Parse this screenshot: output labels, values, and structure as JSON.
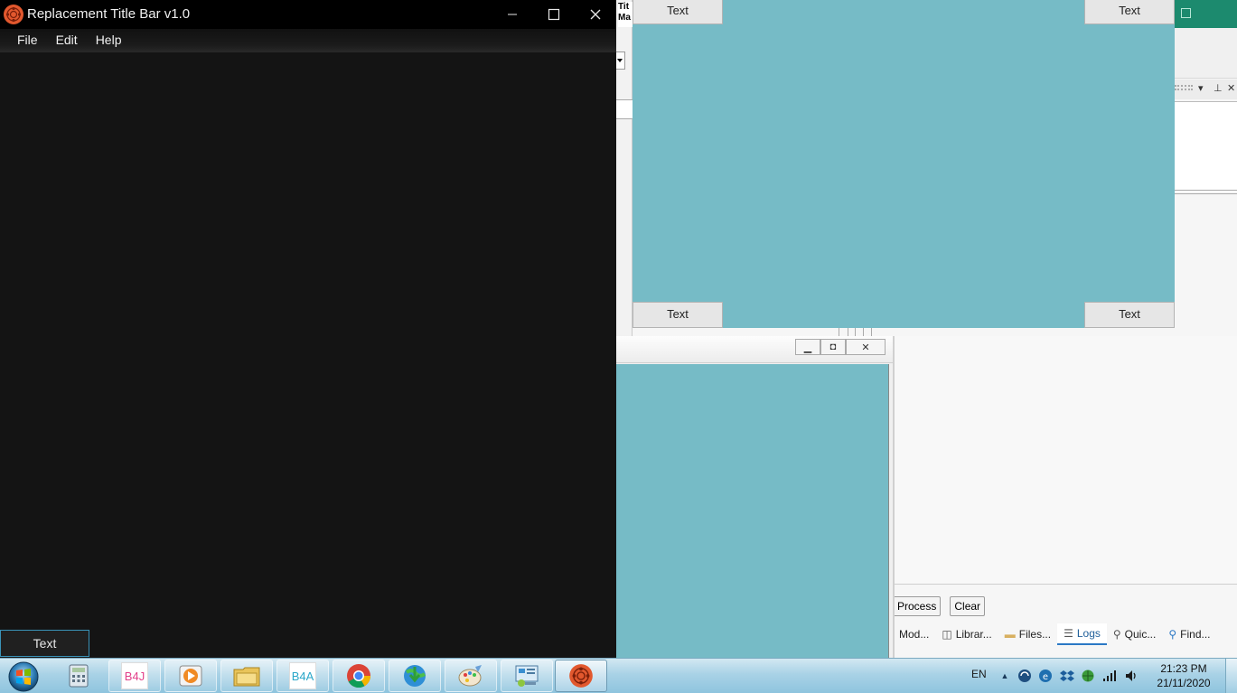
{
  "main_window": {
    "title": "Replacement Title Bar v1.0",
    "menu": [
      "File",
      "Edit",
      "Help"
    ],
    "bottom_button": "Text"
  },
  "designer_form": {
    "buttons": {
      "top_left": "Text",
      "top_right": "Text",
      "bottom_left": "Text",
      "bottom_right": "Text"
    }
  },
  "ide": {
    "title_fragment": "Tit Ma",
    "log_buttons": {
      "process": "Process",
      "clear": "Clear"
    },
    "panel_tabs": [
      {
        "label": "Mod...",
        "icon": ""
      },
      {
        "label": "Librar...",
        "icon": "📖"
      },
      {
        "label": "Files...",
        "icon": "📁"
      },
      {
        "label": "Logs",
        "icon": "☰"
      },
      {
        "label": "Quic...",
        "icon": "🔍"
      },
      {
        "label": "Find...",
        "icon": "🔎"
      }
    ],
    "active_tab": "Logs"
  },
  "taskbar": {
    "apps": [
      {
        "name": "calculator",
        "label": ""
      },
      {
        "name": "b4j",
        "label": "B4J"
      },
      {
        "name": "media-player",
        "label": ""
      },
      {
        "name": "file-explorer",
        "label": ""
      },
      {
        "name": "b4a",
        "label": "B4A"
      },
      {
        "name": "chrome",
        "label": ""
      },
      {
        "name": "download-manager",
        "label": ""
      },
      {
        "name": "paint",
        "label": ""
      },
      {
        "name": "control-panel",
        "label": ""
      },
      {
        "name": "replacement-title-bar-app",
        "label": ""
      }
    ],
    "tray": {
      "language": "EN",
      "time": "21:23 PM",
      "date": "21/11/2020"
    }
  },
  "colors": {
    "main_window_bg": "#141414",
    "form_teal": "#76bbc6",
    "ide_green": "#1c8a6e",
    "app_logo_orange": "#e2582e",
    "focus_border": "#3a92b8"
  }
}
